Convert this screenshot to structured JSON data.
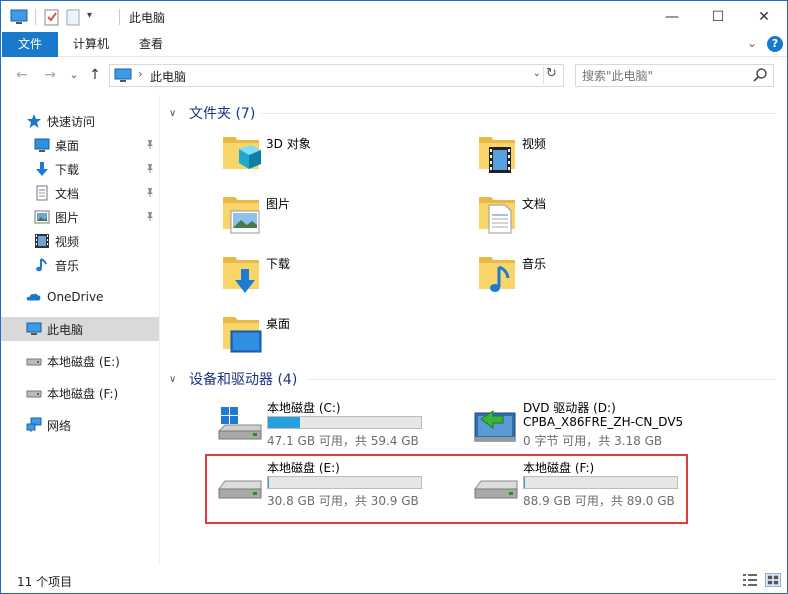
{
  "window": {
    "title": "此电脑",
    "minimize_glyph": "—",
    "maximize_glyph": "☐",
    "close_glyph": "✕"
  },
  "ribbon": {
    "tabs": [
      "文件",
      "计算机",
      "查看"
    ],
    "collapse_glyph": "⌄",
    "help_glyph": "?"
  },
  "nav": {
    "back_glyph": "←",
    "forward_glyph": "→",
    "recent_glyph": "⌄",
    "up_glyph": "↑",
    "address_crumb": "此电脑",
    "address_sep": "›",
    "address_dropdown": "⌄",
    "refresh_glyph": "↻",
    "search_placeholder": "搜索\"此电脑\""
  },
  "sidebar": {
    "items": [
      {
        "label": "快速访问",
        "icon": "star-icon"
      },
      {
        "label": "桌面",
        "icon": "desktop-icon",
        "pinned": true
      },
      {
        "label": "下载",
        "icon": "download-icon",
        "pinned": true
      },
      {
        "label": "文档",
        "icon": "document-icon",
        "pinned": true
      },
      {
        "label": "图片",
        "icon": "picture-icon",
        "pinned": true
      },
      {
        "label": "视频",
        "icon": "video-icon"
      },
      {
        "label": "音乐",
        "icon": "music-icon"
      },
      {
        "label": "OneDrive",
        "icon": "cloud-icon"
      },
      {
        "label": "此电脑",
        "icon": "computer-icon",
        "selected": true
      },
      {
        "label": "本地磁盘 (E:)",
        "icon": "drive-icon"
      },
      {
        "label": "本地磁盘 (F:)",
        "icon": "drive-icon"
      },
      {
        "label": "网络",
        "icon": "network-icon"
      }
    ],
    "pin_glyph": "📌"
  },
  "folders_group": {
    "header": "文件夹 (7)",
    "chevron": "∨",
    "folders": [
      {
        "label": "3D 对象",
        "icon": "3d-objects-icon"
      },
      {
        "label": "视频",
        "icon": "video-folder-icon"
      },
      {
        "label": "图片",
        "icon": "pictures-folder-icon"
      },
      {
        "label": "文档",
        "icon": "documents-folder-icon"
      },
      {
        "label": "下载",
        "icon": "downloads-folder-icon"
      },
      {
        "label": "音乐",
        "icon": "music-folder-icon"
      },
      {
        "label": "桌面",
        "icon": "desktop-folder-icon"
      }
    ]
  },
  "drives_group": {
    "header": "设备和驱动器 (4)",
    "chevron": "∨",
    "drives": [
      {
        "name": "本地磁盘 (C:)",
        "stat": "47.1 GB 可用，共 59.4 GB",
        "used_fraction": 0.207,
        "icon": "windows-drive-icon"
      },
      {
        "name": "DVD 驱动器 (D:)",
        "name2": "CPBA_X86FRE_ZH-CN_DV5",
        "stat": "0 字节 可用，共 3.18 GB",
        "icon": "dvd-drive-icon"
      },
      {
        "name": "本地磁盘 (E:)",
        "stat": "30.8 GB 可用，共 30.9 GB",
        "used_fraction": 0.003,
        "icon": "hard-drive-icon"
      },
      {
        "name": "本地磁盘 (F:)",
        "stat": "88.9 GB 可用，共 89.0 GB",
        "used_fraction": 0.001,
        "icon": "hard-drive-icon"
      }
    ]
  },
  "colors": {
    "accent": "#1979ca",
    "bar_fill": "#26a0da",
    "group_header": "#1e3287",
    "highlight": "#e03c3c"
  },
  "status": {
    "item_count": "11 个项目"
  }
}
